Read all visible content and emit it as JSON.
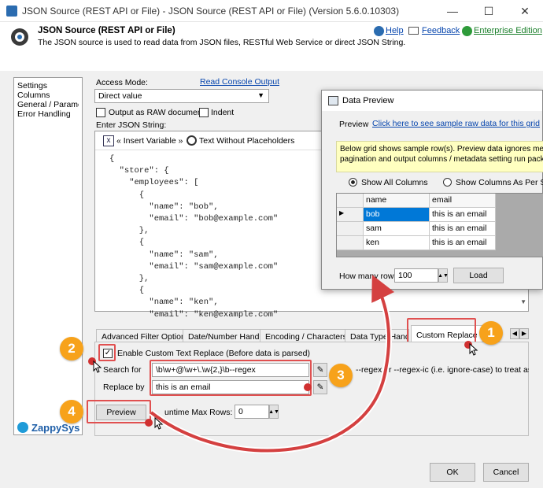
{
  "window": {
    "title": "JSON Source (REST API or File) - JSON Source (REST API or File) (Version 5.6.0.10303)"
  },
  "header": {
    "title": "JSON Source (REST API or File)",
    "description": "The JSON source is used to read data from JSON files, RESTful Web Service or direct JSON String.",
    "help_label": "Help",
    "feedback_label": "Feedback",
    "edition_label": "Enterprise Edition"
  },
  "nav": {
    "items": [
      "Settings",
      "Columns",
      "General / Parameters",
      "Error Handling"
    ]
  },
  "settings": {
    "access_mode_label": "Access Mode:",
    "read_console_label": "Read Console Output",
    "access_mode_value": "Direct value",
    "raw_document_label": "Output as RAW document",
    "indent_label": "Indent",
    "json_string_label": "Enter JSON String:",
    "insert_variable_label": "« Insert Variable »",
    "text_without_placeholders_label": "Text Without Placeholders"
  },
  "json_lines": [
    "{",
    "  \"store\": {",
    "    \"employees\": [",
    "      {",
    "        \"name\": \"bob\",",
    "        \"email\": \"bob@example.com\"",
    "      },",
    "      {",
    "        \"name\": \"sam\",",
    "        \"email\": \"sam@example.com\"",
    "      },",
    "      {",
    "        \"name\": \"ken\",",
    "        \"email\": \"ken@example.com\""
  ],
  "tabs": [
    "Advanced Filter Options",
    "Date/Number Handling",
    "Encoding / Characterset",
    "Data Type Handling",
    "Custom Replace"
  ],
  "custom_replace": {
    "enable_label": "Enable Custom Text Replace (Before data is parsed)",
    "search_label": "Search for",
    "search_value": "\\b\\w+@\\w+\\.\\w{2,}\\b--regex",
    "search_hint": "--regex or --regex-ic (i.e. ignore-case) to treat as Reg",
    "replace_label": "Replace by",
    "replace_value": "this is an email"
  },
  "bottom": {
    "preview_label": "Preview",
    "runtime_label": "untime Max Rows:",
    "runtime_value": "0",
    "ok_label": "OK",
    "cancel_label": "Cancel",
    "brand": "ZappySys"
  },
  "badges": [
    "1",
    "2",
    "3",
    "4"
  ],
  "preview_window": {
    "title": "Data Preview",
    "preview_label": "Preview",
    "sample_link": "Click here to see sample raw data for this grid",
    "notice_line1": "Below grid shows sample row(s). Preview data ignores metadata (",
    "notice_line2": "pagination and output columns / metadata setting run package /",
    "show_all_label": "Show All Columns",
    "show_per_label": "Show Columns As Per Selec",
    "columns": [
      "name",
      "email"
    ],
    "rows": [
      [
        "bob",
        "this is an email"
      ],
      [
        "sam",
        "this is an email"
      ],
      [
        "ken",
        "this is an email"
      ]
    ],
    "how_many_label": "How many rows",
    "how_many_value": "100",
    "load_label": "Load"
  },
  "colors": {
    "accent_red": "#e05050",
    "badge_orange": "#f7a21b",
    "link_blue": "#0645ad",
    "selection_blue": "#0078d7"
  }
}
